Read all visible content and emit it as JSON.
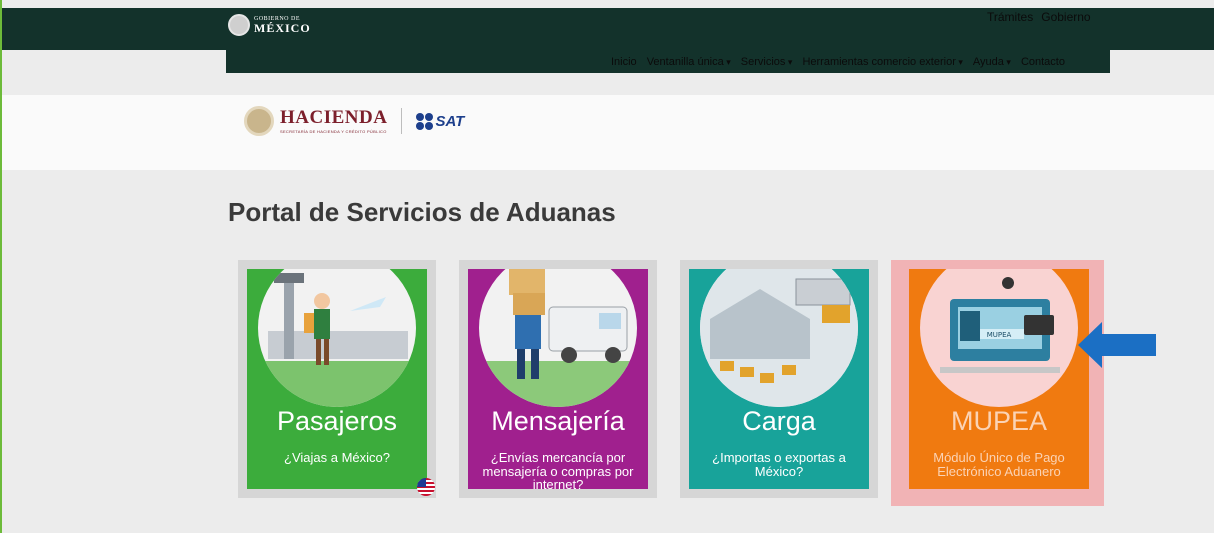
{
  "header": {
    "gob_small": "GOBIERNO DE",
    "gob_big": "MÉXICO",
    "links": [
      "Trámites",
      "Gobierno"
    ]
  },
  "nav": {
    "items": [
      {
        "label": "Inicio",
        "dropdown": false
      },
      {
        "label": "Ventanilla única",
        "dropdown": true
      },
      {
        "label": "Servicios",
        "dropdown": true
      },
      {
        "label": "Herramientas comercio exterior",
        "dropdown": true
      },
      {
        "label": "Ayuda",
        "dropdown": true
      },
      {
        "label": "Contacto",
        "dropdown": false
      }
    ]
  },
  "brand": {
    "hacienda": "HACIENDA",
    "hacienda_sub": "SECRETARÍA DE HACIENDA Y CRÉDITO PÚBLICO",
    "sat": "SAT"
  },
  "page": {
    "title": "Portal de Servicios de Aduanas"
  },
  "cards": [
    {
      "title": "Pasajeros",
      "subtitle": "¿Viajas a México?",
      "color": "#3cac3c"
    },
    {
      "title": "Mensajería",
      "subtitle": "¿Envías mercancía por mensajería o compras por internet?",
      "color": "#a0208e"
    },
    {
      "title": "Carga",
      "subtitle": "¿Importas o exportas a México?",
      "color": "#18a39a"
    },
    {
      "title": "MUPEA",
      "subtitle": "Módulo Único de Pago Electrónico Aduanero",
      "color": "#f07a10",
      "screen_label": "MUPEA"
    }
  ],
  "colors": {
    "header": "#13322b",
    "highlight": "#f1b3b5",
    "arrow": "#1b6fc4"
  },
  "icons": {
    "flag": "us-flag-icon",
    "arrow": "arrow-left-icon"
  }
}
